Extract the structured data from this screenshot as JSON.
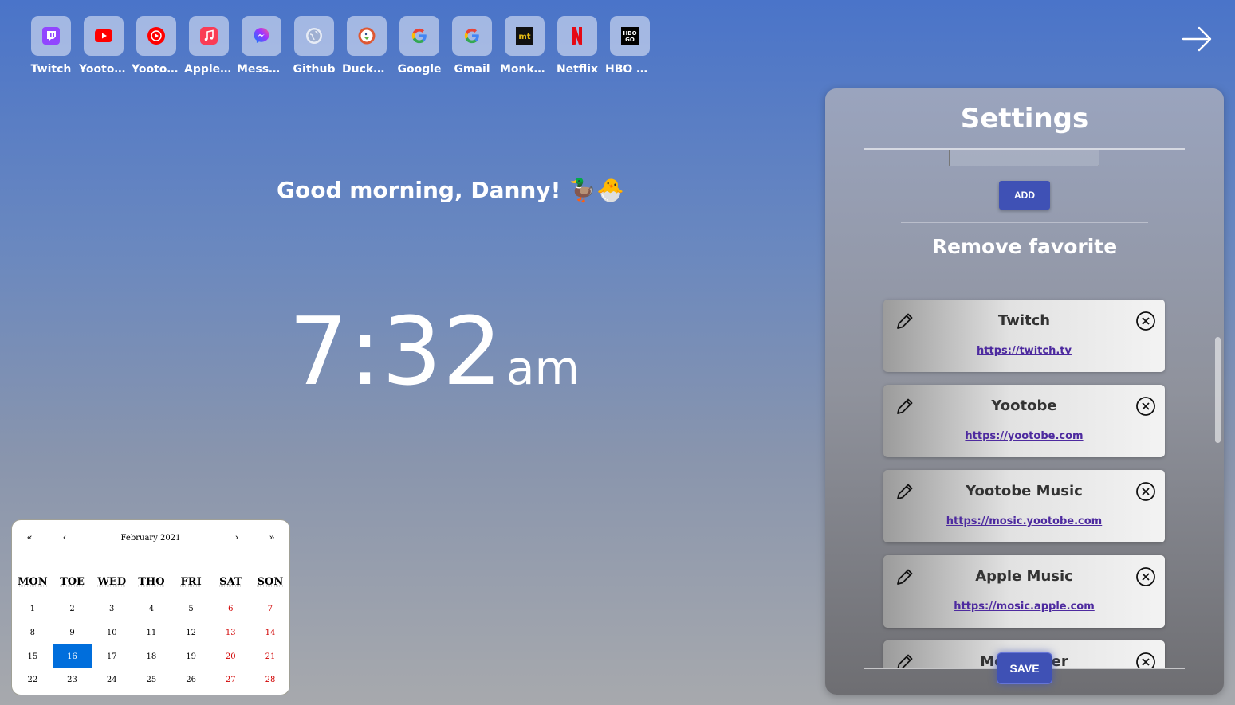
{
  "favorites": [
    {
      "label": "Twitch",
      "icon": "twitch-icon",
      "color": "#9146ff"
    },
    {
      "label": "Yootobe",
      "icon": "youtube-icon",
      "color": "#ff0000"
    },
    {
      "label": "Yootobe Music",
      "icon": "youtube-music-icon",
      "color": "#ff0000"
    },
    {
      "label": "Apple Music",
      "icon": "apple-music-icon",
      "color": "#fa3c55"
    },
    {
      "label": "Messenger",
      "icon": "messenger-icon",
      "color": "#7b4dff"
    },
    {
      "label": "Github",
      "icon": "globe-icon",
      "color": "#8a9ab8"
    },
    {
      "label": "DuckDuckGo",
      "icon": "duckduckgo-icon",
      "color": "#de5833"
    },
    {
      "label": "Google",
      "icon": "google-icon",
      "color": "#4285f4"
    },
    {
      "label": "Gmail",
      "icon": "google-icon",
      "color": "#4285f4"
    },
    {
      "label": "Monkeytype",
      "icon": "monkeytype-icon",
      "color": "#e2b714"
    },
    {
      "label": "Netflix",
      "icon": "netflix-icon",
      "color": "#e50914"
    },
    {
      "label": "HBO GO",
      "icon": "hbo-icon",
      "color": "#000000"
    }
  ],
  "greeting": "Good morning, Danny! 🦆🐣",
  "clock": {
    "time": "7:32",
    "ampm": "am"
  },
  "calendar": {
    "prev_year": "«",
    "prev_month": "‹",
    "month_label": "February 2021",
    "next_month": "›",
    "next_year": "»",
    "weekdays": [
      "MON",
      "TOE",
      "WED",
      "THO",
      "FRI",
      "SAT",
      "SON"
    ],
    "days": [
      "1",
      "2",
      "3",
      "4",
      "5",
      "6",
      "7",
      "8",
      "9",
      "10",
      "11",
      "12",
      "13",
      "14",
      "15",
      "16",
      "17",
      "18",
      "19",
      "20",
      "21",
      "22",
      "23",
      "24",
      "25",
      "26",
      "27",
      "28"
    ],
    "selected_day": "16",
    "accent": "#006edc"
  },
  "settings": {
    "title": "Settings",
    "add_label": "ADD",
    "remove_title": "Remove favorite",
    "save_label": "SAVE",
    "accent": "#3f51b5",
    "items": [
      {
        "name": "Twitch",
        "url": "https://twitch.tv"
      },
      {
        "name": "Yootobe",
        "url": "https://yootobe.com"
      },
      {
        "name": "Yootobe Music",
        "url": "https://mosic.yootobe.com"
      },
      {
        "name": "Apple Music",
        "url": "https://mosic.apple.com"
      },
      {
        "name": "Messenger",
        "url": ""
      }
    ]
  }
}
